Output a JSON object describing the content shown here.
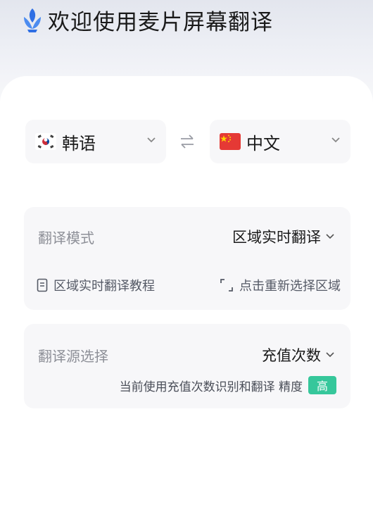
{
  "header": {
    "title": "欢迎使用麦片屏幕翻译",
    "logo_icon": "leaf-logo-icon"
  },
  "languages": {
    "source": {
      "label": "韩语",
      "flag": "kr-flag-icon"
    },
    "target": {
      "label": "中文",
      "flag": "cn-flag-icon"
    },
    "swap_icon": "swap-arrows-icon"
  },
  "mode_card": {
    "label": "翻译模式",
    "value": "区域实时翻译",
    "tutorial_link": "区域实时翻译教程",
    "reselect_link": "点击重新选择区域"
  },
  "source_card": {
    "label": "翻译源选择",
    "value": "充值次数",
    "hint": "当前使用充值次数识别和翻译 精度",
    "badge": "高"
  },
  "colors": {
    "accent_badge": "#36c79b",
    "logo_blue": "#2f6fe4",
    "card_bg": "#f7f7f9"
  }
}
